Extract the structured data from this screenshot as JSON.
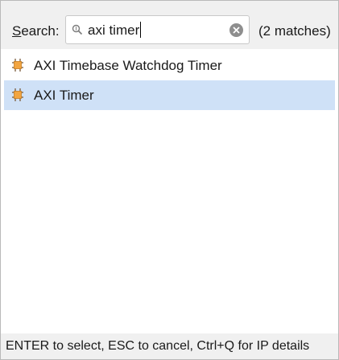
{
  "search": {
    "label_first": "S",
    "label_rest": "earch:",
    "value": "axi timer",
    "match_count": "(2 matches)"
  },
  "results": [
    {
      "label": "AXI Timebase Watchdog Timer",
      "icon": "ip-core-icon",
      "selected": false
    },
    {
      "label": "AXI Timer",
      "icon": "ip-core-icon",
      "selected": true
    }
  ],
  "status": {
    "hint": "ENTER to select, ESC to cancel, Ctrl+Q for IP details"
  },
  "colors": {
    "selection": "#cfe1f7",
    "panel_bg": "#f0f0f0",
    "icon_orange": "#f2a541",
    "icon_brown": "#7a5a3a"
  }
}
